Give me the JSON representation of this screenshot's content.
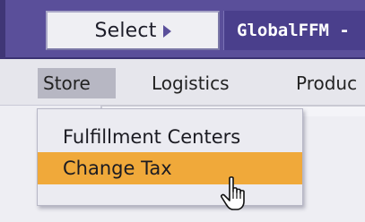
{
  "header": {
    "select_label": "Select",
    "org_name": "GlobalFFM -"
  },
  "menubar": {
    "items": [
      {
        "label": "Store"
      },
      {
        "label": "Logistics"
      },
      {
        "label": "Produc"
      }
    ]
  },
  "dropdown": {
    "items": [
      {
        "label": "Fulfillment Centers"
      },
      {
        "label": "Change Tax"
      }
    ]
  },
  "colors": {
    "banner": "#5a4f9a",
    "highlight": "#f0a93a",
    "menu_active": "#b7b7c3"
  },
  "icons": {
    "caret": "caret-right-icon",
    "cursor": "hand-pointer-cursor-icon"
  }
}
